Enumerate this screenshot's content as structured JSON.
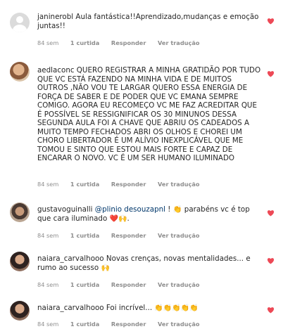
{
  "comments": [
    {
      "username": "janinerobl",
      "text": "Aula fantástica!!Aprendizado,mudanças e emoção juntas!!",
      "time": "84 sem",
      "likes": "1 curtida",
      "reply": "Responder",
      "translate": "Ver tradução"
    },
    {
      "username": "aedlaconc",
      "text": "QUERO REGISTRAR A MINHA GRATIDÃO POR TUDO QUE VC ESTÁ FAZENDO NA MINHA VIDA E DE MUITOS OUTROS ,NÃO VOU TE LARGAR QUERO ESSA ENERGIA DE FORÇA DE SABER E DE PODER QUE VC EMANA SEMPRE COMIGO. AGORA EU RECOMEÇO VC ME FAZ ACREDITAR QUE É POSSÍVEL SE RESSIGNIFICAR OS 30 MINUNOS DESSA SEGUNDA AULA FOI A CHAVE QUE ABRIU OS CADEADOS A MUITO TEMPO FECHADOS ABRI OS OLHOS E CHOREI UM CHORO LIBERTADOR É UM ALÍVIO INEXPLICÁVEL QUE ME TOMOU E SINTO QUE ESTOU MAIS FORTE E CAPAZ DE ENCARAR O NOVO. VC É UM SER HUMANO ILUMINADO",
      "time": "84 sem",
      "likes": "1 curtida",
      "reply": "Responder",
      "translate": "Ver tradução"
    },
    {
      "username": "gustavoguinalli",
      "mention": "@plinio desouzapnl",
      "text_a": "! 👏 parabéns vc é top que cara iluminado",
      "text_b": "❤️🙌",
      "text_c": ".",
      "time": "84 sem",
      "likes": "1 curtida",
      "reply": "Responder",
      "translate": "Ver tradução"
    },
    {
      "username": "naiara_carvalhooo",
      "text": "Novas crenças, novas mentalidades... e rumo ao sucesso",
      "emoji": "🙌",
      "time": "84 sem",
      "likes": "1 curtida",
      "reply": "Responder",
      "translate": "Ver tradução"
    },
    {
      "username": "naiara_carvalhooo",
      "text": "Foi incrível...",
      "emoji": "👏👏👏👏👏",
      "time": "84 sem",
      "likes": "1 curtida",
      "reply": "Responder",
      "translate": "Ver tradução"
    }
  ],
  "colors": {
    "heart": "#ed4956",
    "meta": "#8e8e8e",
    "mention": "#00376b"
  },
  "icons": {
    "like": "heart-icon",
    "avatar": "avatar"
  }
}
